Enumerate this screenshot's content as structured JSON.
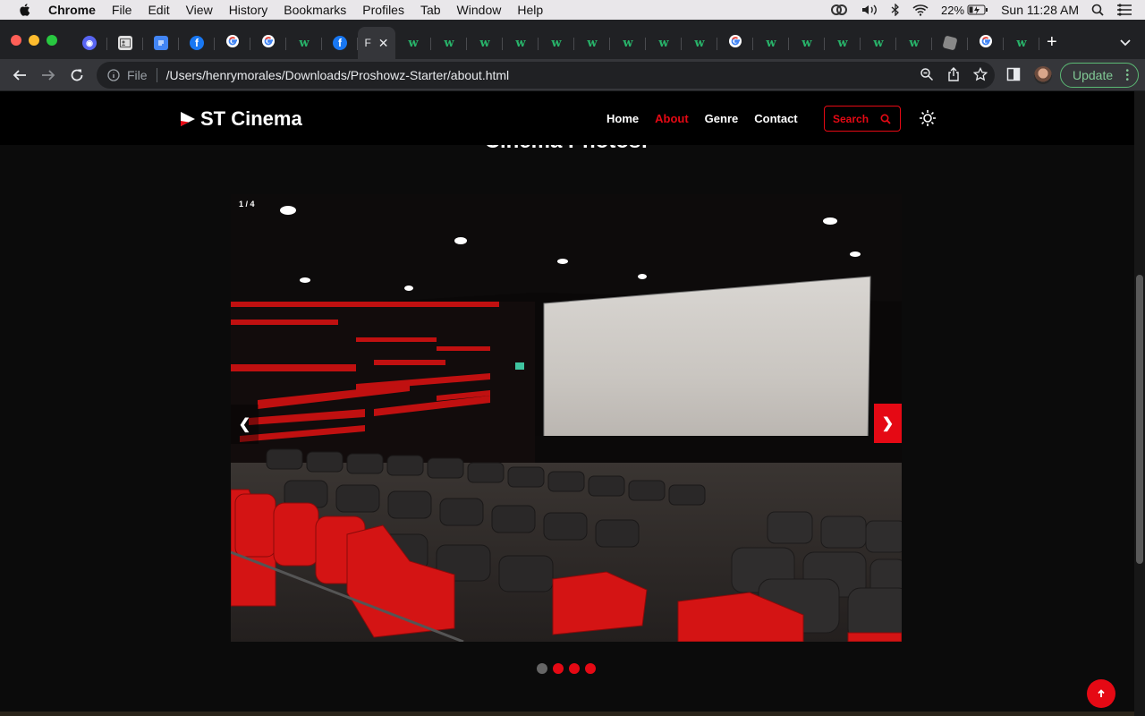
{
  "menubar": {
    "app": "Chrome",
    "items": [
      "File",
      "Edit",
      "View",
      "History",
      "Bookmarks",
      "Profiles",
      "Tab",
      "Window",
      "Help"
    ],
    "battery": "22%",
    "clock": "Sun 11:28 AM"
  },
  "tabs": {
    "favicons": [
      "discord-icon",
      "contact-card-icon",
      "google-docs-icon",
      "facebook-icon",
      "google-icon",
      "google-icon",
      "w-icon",
      "facebook-icon",
      "active-tab",
      "w-icon",
      "w-icon",
      "w-icon",
      "w-icon",
      "w-icon",
      "w-icon",
      "w-icon",
      "w-icon",
      "w-icon",
      "google-icon",
      "w-icon",
      "w-icon",
      "w-icon",
      "w-icon",
      "w-icon",
      "roblox-icon",
      "google-icon",
      "w-icon"
    ],
    "active_tab_letter": "F",
    "new_tab": "+"
  },
  "toolbar": {
    "scheme": "File",
    "url": "/Users/henrymorales/Downloads/Proshowz-Starter/about.html",
    "update_label": "Update"
  },
  "site": {
    "logo": "ST Cinema",
    "nav": [
      "Home",
      "About",
      "Genre",
      "Contact"
    ],
    "active_nav": "About",
    "search_label": "Search",
    "section_title": "Cinema Photos:",
    "slide_counter": "1 / 4",
    "prev_label": "❮",
    "next_label": "❯",
    "slide_count": 4,
    "active_slide": 1
  },
  "colors": {
    "accent": "#e50914",
    "page_bg": "#0b0b0b",
    "update_green": "#81c995"
  }
}
